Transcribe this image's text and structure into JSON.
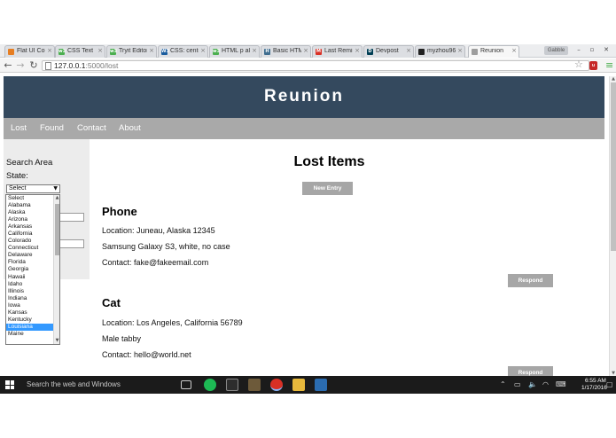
{
  "browser": {
    "tabs": [
      {
        "label": "Flat UI Colo",
        "favicon": "flatui-icon",
        "fav_text": "",
        "fav_color": "#e67e22",
        "active": false
      },
      {
        "label": "CSS Text",
        "favicon": "w3schools-icon",
        "fav_text": "w3",
        "fav_color": "#4caf50",
        "active": false
      },
      {
        "label": "Tryit Editor",
        "favicon": "w3schools-icon",
        "fav_text": "w3",
        "fav_color": "#4caf50",
        "active": false
      },
      {
        "label": "CSS: center",
        "favicon": "w3c-icon",
        "fav_text": "W3",
        "fav_color": "#1a5c9e",
        "active": false
      },
      {
        "label": "HTML p alig",
        "favicon": "w3schools-icon",
        "fav_text": "w3",
        "fav_color": "#4caf50",
        "active": false
      },
      {
        "label": "Basic HTML",
        "favicon": "htmldog-icon",
        "fav_text": "H",
        "fav_color": "#3f6d8f",
        "active": false
      },
      {
        "label": "Last Remin",
        "favicon": "gmail-icon",
        "fav_text": "M",
        "fav_color": "#d93025",
        "active": false
      },
      {
        "label": "Devpost",
        "favicon": "devpost-icon",
        "fav_text": "D",
        "fav_color": "#003e54",
        "active": false
      },
      {
        "label": "myzhou96",
        "favicon": "github-icon",
        "fav_text": "",
        "fav_color": "#222222",
        "active": false
      },
      {
        "label": "Reunion",
        "favicon": "page-icon",
        "fav_text": "",
        "fav_color": "#9e9e9e",
        "active": true
      }
    ],
    "profile_label": "Gabble",
    "url_host": "127.0.0.1",
    "url_path": ":5000/lost"
  },
  "site": {
    "title": "Reunion",
    "nav": [
      "Lost",
      "Found",
      "Contact",
      "About"
    ]
  },
  "sidebar": {
    "search_area_label": "Search Area",
    "state_label": "State:",
    "state_selected": "Select"
  },
  "state_options": [
    "Select",
    "Alabama",
    "Alaska",
    "Arizona",
    "Arkansas",
    "California",
    "Colorado",
    "Connecticut",
    "Delaware",
    "Florida",
    "Georgia",
    "Hawaii",
    "Idaho",
    "Illinois",
    "Indiana",
    "Iowa",
    "Kansas",
    "Kentucky",
    "Louisiana",
    "Maine"
  ],
  "highlighted_state": "Louisiana",
  "main": {
    "heading": "Lost Items",
    "new_entry_label": "New Entry",
    "respond_label": "Respond",
    "items": [
      {
        "title": "Phone",
        "location": "Location: Juneau, Alaska 12345",
        "description": "Samsung Galaxy S3, white, no case",
        "contact": "Contact: fake@fakeemail.com"
      },
      {
        "title": "Cat",
        "location": "Location: Los Angeles, California 56789",
        "description": "Male tabby",
        "contact": "Contact: hello@world.net"
      }
    ]
  },
  "taskbar": {
    "search_placeholder": "Search the web and Windows",
    "time": "6:55 AM",
    "date": "1/17/2016"
  },
  "colors": {
    "header_bg": "#34495e",
    "nav_bg": "#a9a9a9",
    "button_bg": "#a6a6a6",
    "highlight": "#3399ff"
  }
}
